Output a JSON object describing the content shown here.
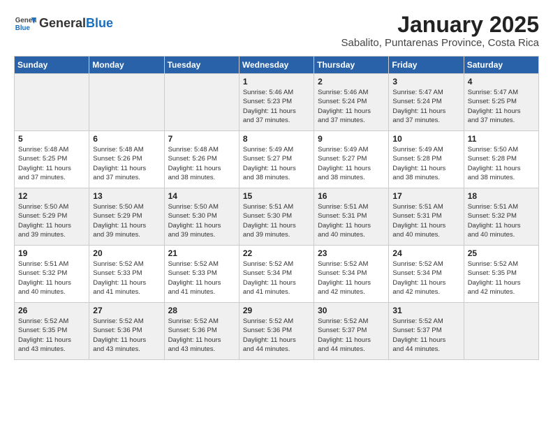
{
  "header": {
    "logo_general": "General",
    "logo_blue": "Blue",
    "month": "January 2025",
    "location": "Sabalito, Puntarenas Province, Costa Rica"
  },
  "days_of_week": [
    "Sunday",
    "Monday",
    "Tuesday",
    "Wednesday",
    "Thursday",
    "Friday",
    "Saturday"
  ],
  "weeks": [
    [
      {
        "num": "",
        "info": ""
      },
      {
        "num": "",
        "info": ""
      },
      {
        "num": "",
        "info": ""
      },
      {
        "num": "1",
        "info": "Sunrise: 5:46 AM\nSunset: 5:23 PM\nDaylight: 11 hours\nand 37 minutes."
      },
      {
        "num": "2",
        "info": "Sunrise: 5:46 AM\nSunset: 5:24 PM\nDaylight: 11 hours\nand 37 minutes."
      },
      {
        "num": "3",
        "info": "Sunrise: 5:47 AM\nSunset: 5:24 PM\nDaylight: 11 hours\nand 37 minutes."
      },
      {
        "num": "4",
        "info": "Sunrise: 5:47 AM\nSunset: 5:25 PM\nDaylight: 11 hours\nand 37 minutes."
      }
    ],
    [
      {
        "num": "5",
        "info": "Sunrise: 5:48 AM\nSunset: 5:25 PM\nDaylight: 11 hours\nand 37 minutes."
      },
      {
        "num": "6",
        "info": "Sunrise: 5:48 AM\nSunset: 5:26 PM\nDaylight: 11 hours\nand 37 minutes."
      },
      {
        "num": "7",
        "info": "Sunrise: 5:48 AM\nSunset: 5:26 PM\nDaylight: 11 hours\nand 38 minutes."
      },
      {
        "num": "8",
        "info": "Sunrise: 5:49 AM\nSunset: 5:27 PM\nDaylight: 11 hours\nand 38 minutes."
      },
      {
        "num": "9",
        "info": "Sunrise: 5:49 AM\nSunset: 5:27 PM\nDaylight: 11 hours\nand 38 minutes."
      },
      {
        "num": "10",
        "info": "Sunrise: 5:49 AM\nSunset: 5:28 PM\nDaylight: 11 hours\nand 38 minutes."
      },
      {
        "num": "11",
        "info": "Sunrise: 5:50 AM\nSunset: 5:28 PM\nDaylight: 11 hours\nand 38 minutes."
      }
    ],
    [
      {
        "num": "12",
        "info": "Sunrise: 5:50 AM\nSunset: 5:29 PM\nDaylight: 11 hours\nand 39 minutes."
      },
      {
        "num": "13",
        "info": "Sunrise: 5:50 AM\nSunset: 5:29 PM\nDaylight: 11 hours\nand 39 minutes."
      },
      {
        "num": "14",
        "info": "Sunrise: 5:50 AM\nSunset: 5:30 PM\nDaylight: 11 hours\nand 39 minutes."
      },
      {
        "num": "15",
        "info": "Sunrise: 5:51 AM\nSunset: 5:30 PM\nDaylight: 11 hours\nand 39 minutes."
      },
      {
        "num": "16",
        "info": "Sunrise: 5:51 AM\nSunset: 5:31 PM\nDaylight: 11 hours\nand 40 minutes."
      },
      {
        "num": "17",
        "info": "Sunrise: 5:51 AM\nSunset: 5:31 PM\nDaylight: 11 hours\nand 40 minutes."
      },
      {
        "num": "18",
        "info": "Sunrise: 5:51 AM\nSunset: 5:32 PM\nDaylight: 11 hours\nand 40 minutes."
      }
    ],
    [
      {
        "num": "19",
        "info": "Sunrise: 5:51 AM\nSunset: 5:32 PM\nDaylight: 11 hours\nand 40 minutes."
      },
      {
        "num": "20",
        "info": "Sunrise: 5:52 AM\nSunset: 5:33 PM\nDaylight: 11 hours\nand 41 minutes."
      },
      {
        "num": "21",
        "info": "Sunrise: 5:52 AM\nSunset: 5:33 PM\nDaylight: 11 hours\nand 41 minutes."
      },
      {
        "num": "22",
        "info": "Sunrise: 5:52 AM\nSunset: 5:34 PM\nDaylight: 11 hours\nand 41 minutes."
      },
      {
        "num": "23",
        "info": "Sunrise: 5:52 AM\nSunset: 5:34 PM\nDaylight: 11 hours\nand 42 minutes."
      },
      {
        "num": "24",
        "info": "Sunrise: 5:52 AM\nSunset: 5:34 PM\nDaylight: 11 hours\nand 42 minutes."
      },
      {
        "num": "25",
        "info": "Sunrise: 5:52 AM\nSunset: 5:35 PM\nDaylight: 11 hours\nand 42 minutes."
      }
    ],
    [
      {
        "num": "26",
        "info": "Sunrise: 5:52 AM\nSunset: 5:35 PM\nDaylight: 11 hours\nand 43 minutes."
      },
      {
        "num": "27",
        "info": "Sunrise: 5:52 AM\nSunset: 5:36 PM\nDaylight: 11 hours\nand 43 minutes."
      },
      {
        "num": "28",
        "info": "Sunrise: 5:52 AM\nSunset: 5:36 PM\nDaylight: 11 hours\nand 43 minutes."
      },
      {
        "num": "29",
        "info": "Sunrise: 5:52 AM\nSunset: 5:36 PM\nDaylight: 11 hours\nand 44 minutes."
      },
      {
        "num": "30",
        "info": "Sunrise: 5:52 AM\nSunset: 5:37 PM\nDaylight: 11 hours\nand 44 minutes."
      },
      {
        "num": "31",
        "info": "Sunrise: 5:52 AM\nSunset: 5:37 PM\nDaylight: 11 hours\nand 44 minutes."
      },
      {
        "num": "",
        "info": ""
      }
    ]
  ]
}
